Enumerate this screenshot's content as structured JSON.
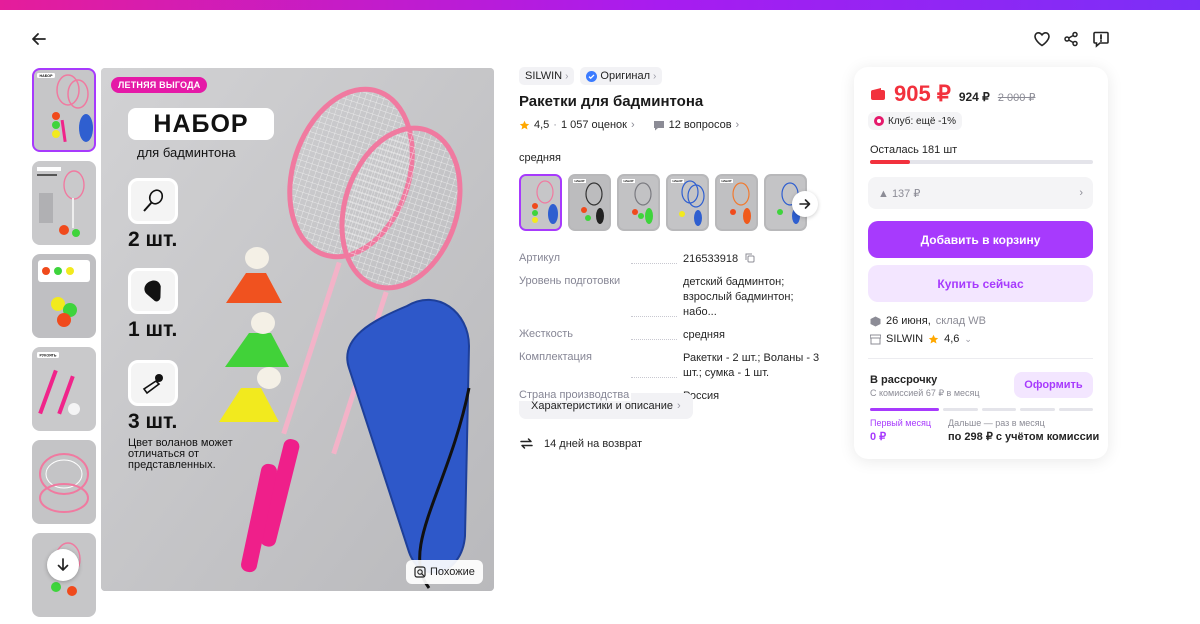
{
  "colors": {
    "accent": "#a73afd",
    "price": "#f2313d",
    "promo": "#e519a7"
  },
  "header": {
    "icons": [
      "arrow-left-icon",
      "heart-icon",
      "share-icon",
      "report-icon"
    ]
  },
  "gallery": {
    "thumb_label": "НАБОР",
    "main": {
      "promo_badge": "ЛЕТНЯЯ ВЫГОДА",
      "set_title": "НАБОР",
      "set_subtitle": "для бадминтона",
      "items": [
        {
          "icon": "racket-icon",
          "count": "2 шт."
        },
        {
          "icon": "case-icon",
          "count": "1 шт."
        },
        {
          "icon": "shuttlecock-icon",
          "count": "3 шт."
        }
      ],
      "note": "Цвет воланов может отличаться от представленных.",
      "similar_button": "Похожие"
    },
    "thumb_labels": [
      "",
      "",
      "",
      "РУКОЯТЬ",
      "",
      ""
    ]
  },
  "product": {
    "brand": "SILWIN",
    "original": "Оригинал",
    "title": "Ракетки для бадминтона",
    "rating": "4,5",
    "reviews": "1 057 оценок",
    "questions": "12 вопросов",
    "variant_label": "средняя",
    "variant_thumb_label": "НАБОР",
    "specs": [
      {
        "key": "Артикул",
        "value": "216533918"
      },
      {
        "key": "Уровень подготовки",
        "value": "детский бадминтон; взрослый бадминтон; набо..."
      },
      {
        "key": "Жесткость",
        "value": "средняя"
      },
      {
        "key": "Комплектация",
        "value": "Ракетки - 2 шт.; Воланы - 3 шт.; сумка - 1 шт."
      },
      {
        "key": "Страна производства",
        "value": "Россия"
      }
    ],
    "characteristics_button": "Характеристики и описание",
    "return_text": "14 дней на возврат"
  },
  "buy_card": {
    "price": "905 ₽",
    "price_old": "924 ₽",
    "price_strike": "2 000 ₽",
    "club": "Клуб: ещё -1%",
    "stock": "Осталась 181 шт",
    "stock_fraction": 0.18,
    "coupon": "▲ 137 ₽",
    "add_to_cart": "Добавить в корзину",
    "buy_now": "Купить сейчас",
    "delivery_date": "26 июня,",
    "delivery_warehouse": "склад WB",
    "seller": "SILWIN",
    "seller_rating": "4,6",
    "installment": {
      "title": "В рассрочку",
      "subtitle": "С комиссией 67 ₽ в месяц",
      "button": "Оформить",
      "first_label": "Первый месяц",
      "first_value": "0 ₽",
      "next_label": "Дальше — раз в месяц",
      "next_value": "по 298 ₽ с учётом комиссии"
    }
  }
}
